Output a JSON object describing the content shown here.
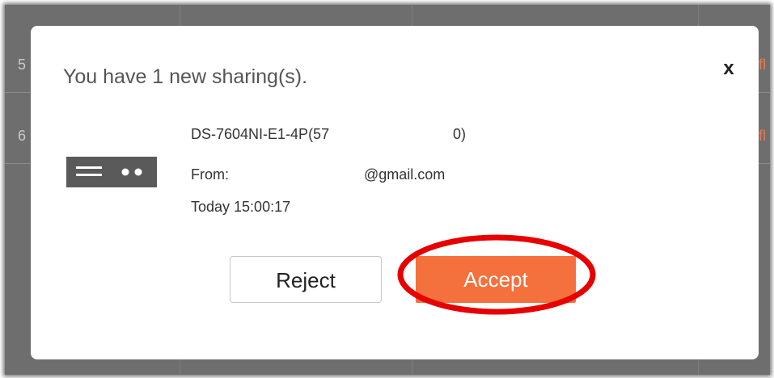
{
  "dialog": {
    "title": "You have 1 new sharing(s).",
    "close_label": "x",
    "device_name_part1": "DS-7604NI-E1-4P(57",
    "device_name_part2": "0)",
    "from_label": "From:",
    "from_email": "@gmail.com",
    "timestamp": "Today 15:00:17",
    "reject_label": "Reject",
    "accept_label": "Accept"
  },
  "background": {
    "row_numbers": [
      "5",
      "6"
    ],
    "side_text": [
      "fl",
      "fl"
    ]
  },
  "colors": {
    "accent": "#f4703c",
    "highlight": "#e60000",
    "icon": "#5a5a5a",
    "overlay": "#6e6e6e"
  },
  "icons": {
    "device": "nvr-device-icon",
    "close": "close-icon"
  }
}
